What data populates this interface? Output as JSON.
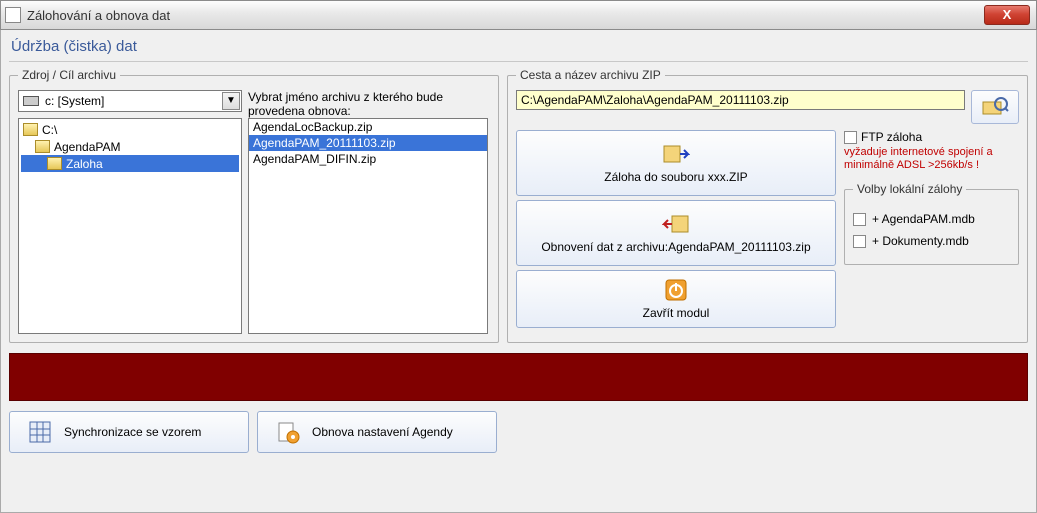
{
  "window": {
    "title": "Zálohování a obnova dat",
    "subtitle": "Údržba (čistka) dat"
  },
  "source": {
    "legend": "Zdroj / Cíl archivu",
    "drive_selected": "c: [System]",
    "tree": {
      "root": "C:\\",
      "level1": "AgendaPAM",
      "level2_selected": "Zaloha"
    },
    "archive_label": "Vybrat jméno archivu z kterého bude provedena obnova:",
    "archives": {
      "item0": "AgendaLocBackup.zip",
      "item1_selected": "AgendaPAM_20111103.zip",
      "item2": "AgendaPAM_DIFIN.zip"
    }
  },
  "dest": {
    "legend": "Cesta a název archivu ZIP",
    "path": "C:\\AgendaPAM\\Zaloha\\AgendaPAM_20111103.zip",
    "btn_backup": "Záloha do souboru xxx.ZIP",
    "btn_restore": "Obnovení dat z archivu:AgendaPAM_20111103.zip",
    "btn_close": "Zavřít modul",
    "ftp_label": "FTP záloha",
    "ftp_warning": "vyžaduje internetové spojení a minimálně ADSL >256kb/s !",
    "local_legend": "Volby lokální zálohy",
    "opt_agenda": "+ AgendaPAM.mdb",
    "opt_dokumenty": "+ Dokumenty.mdb"
  },
  "bottom": {
    "sync": "Synchronizace se vzorem",
    "restore_settings": "Obnova nastavení Agendy"
  }
}
